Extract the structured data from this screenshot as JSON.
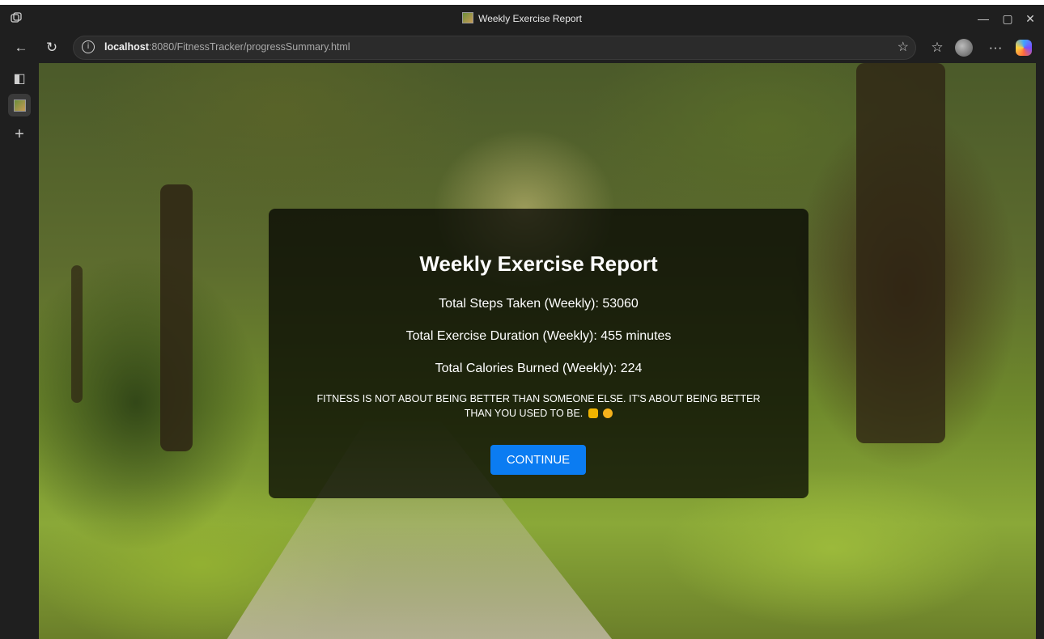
{
  "browser": {
    "tab_title": "Weekly Exercise Report",
    "url_host": "localhost",
    "url_path": ":8080/FitnessTracker/progressSummary.html"
  },
  "report": {
    "title": "Weekly Exercise Report",
    "steps": "Total Steps Taken (Weekly): 53060",
    "duration": "Total Exercise Duration (Weekly): 455 minutes",
    "calories": "Total Calories Burned (Weekly): 224",
    "quote_line1": "FITNESS IS NOT ABOUT BEING BETTER THAN SOMEONE ELSE. IT'S ABOUT BEING BETTER",
    "quote_line2": "THAN YOU USED TO BE.",
    "continue_label": "CONTINUE"
  },
  "colors": {
    "button": "#0b7cf2",
    "card_overlay": "rgba(0,0,0,0.72)"
  },
  "icons": {
    "quote_emojis": [
      "flexed-biceps-icon",
      "smiling-face-icon"
    ]
  }
}
